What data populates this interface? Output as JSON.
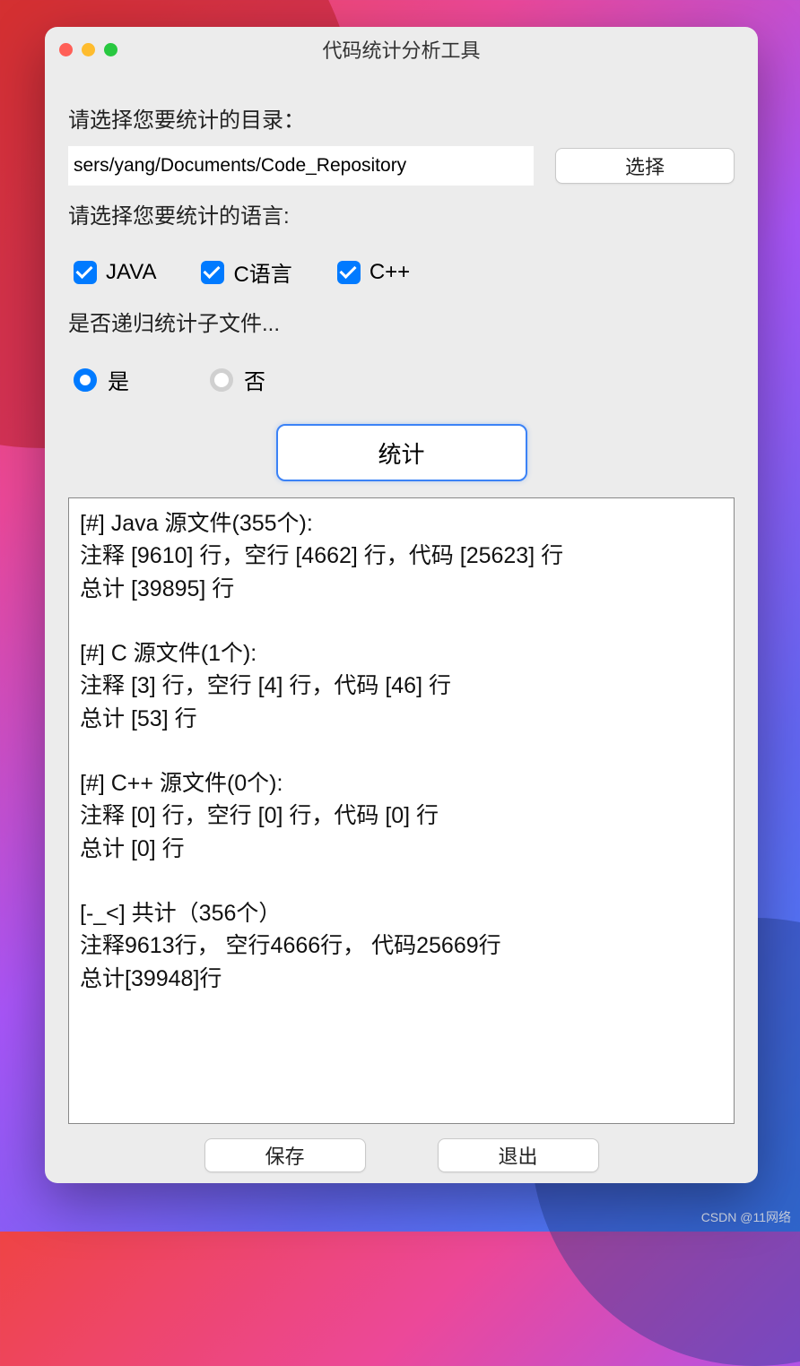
{
  "window": {
    "title": "代码统计分析工具"
  },
  "form": {
    "dir_label": "请选择您要统计的目录：",
    "dir_value": "sers/yang/Documents/Code_Repository",
    "choose_btn": "选择",
    "lang_label": "请选择您要统计的语言:",
    "checks": {
      "java": "JAVA",
      "c": "C语言",
      "cpp": "C++"
    },
    "recurse_label": "是否递归统计子文件...",
    "radio_yes": "是",
    "radio_no": "否",
    "analyze_btn": "统计",
    "save_btn": "保存",
    "exit_btn": "退出"
  },
  "output": {
    "text": "[#] Java 源文件(355个):\n   注释 [9610] 行，空行 [4662] 行，代码 [25623] 行\n   总计 [39895] 行\n\n[#] C 源文件(1个):\n   注释 [3] 行，空行 [4] 行，代码 [46] 行\n   总计 [53] 行\n\n[#] C++ 源文件(0个):\n   注释 [0] 行，空行 [0] 行，代码 [0] 行\n   总计 [0] 行\n\n[-_<] 共计（356个）\n   注释9613行， 空行4666行， 代码25669行\n   总计[39948]行"
  },
  "watermark": "CSDN @11网络"
}
